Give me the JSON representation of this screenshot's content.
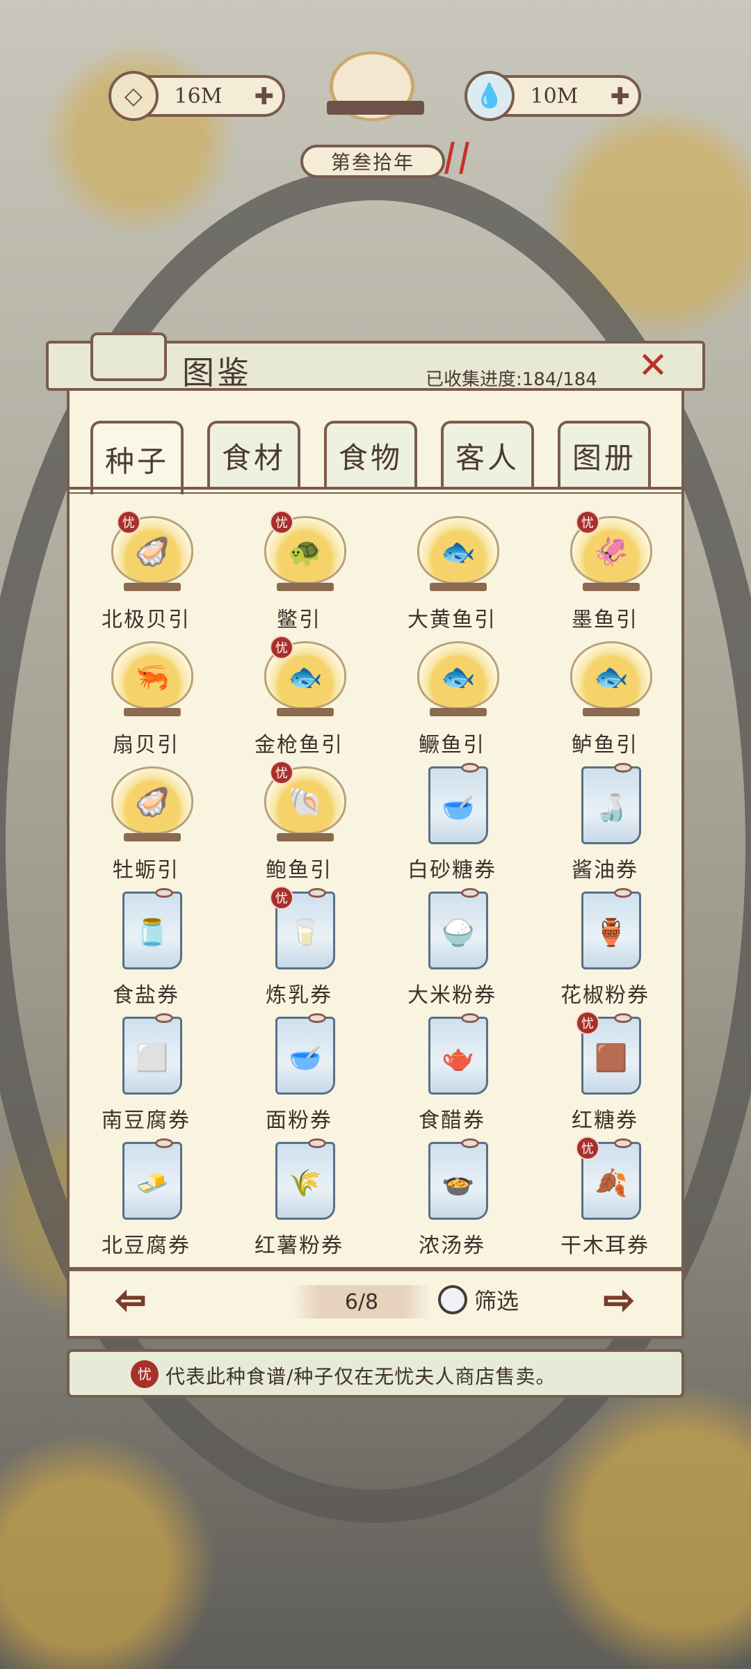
{
  "header": {
    "currency_left": {
      "value": "16M",
      "icon": "coin-icon"
    },
    "currency_right": {
      "value": "10M",
      "icon": "water-drop-icon"
    },
    "year_label": "第叁拾年"
  },
  "panel": {
    "title": "图鉴",
    "progress_label": "已收集进度:",
    "progress_value": "184/184",
    "close_icon": "close-icon"
  },
  "tabs": [
    {
      "label": "种子",
      "active": true
    },
    {
      "label": "食材",
      "active": false
    },
    {
      "label": "食物",
      "active": false
    },
    {
      "label": "客人",
      "active": false
    },
    {
      "label": "图册",
      "active": false
    }
  ],
  "items": [
    {
      "name": "北极贝引",
      "glyph": "🦪",
      "type": "bowl",
      "badge": true
    },
    {
      "name": "鳖引",
      "glyph": "🐢",
      "type": "bowl",
      "badge": true
    },
    {
      "name": "大黄鱼引",
      "glyph": "🐟",
      "type": "bowl",
      "badge": false
    },
    {
      "name": "墨鱼引",
      "glyph": "🦑",
      "type": "bowl",
      "badge": true
    },
    {
      "name": "扇贝引",
      "glyph": "🦐",
      "type": "bowl",
      "badge": false
    },
    {
      "name": "金枪鱼引",
      "glyph": "🐟",
      "type": "bowl",
      "badge": true
    },
    {
      "name": "鳜鱼引",
      "glyph": "🐟",
      "type": "bowl",
      "badge": false
    },
    {
      "name": "鲈鱼引",
      "glyph": "🐟",
      "type": "bowl",
      "badge": false
    },
    {
      "name": "牡蛎引",
      "glyph": "🦪",
      "type": "bowl",
      "badge": false
    },
    {
      "name": "鲍鱼引",
      "glyph": "🐚",
      "type": "bowl",
      "badge": true
    },
    {
      "name": "白砂糖券",
      "glyph": "🥣",
      "type": "coupon",
      "badge": false
    },
    {
      "name": "酱油券",
      "glyph": "🍶",
      "type": "coupon",
      "badge": false
    },
    {
      "name": "食盐券",
      "glyph": "🫙",
      "type": "coupon",
      "badge": false
    },
    {
      "name": "炼乳券",
      "glyph": "🥛",
      "type": "coupon",
      "badge": true
    },
    {
      "name": "大米粉券",
      "glyph": "🍚",
      "type": "coupon",
      "badge": false
    },
    {
      "name": "花椒粉券",
      "glyph": "🏺",
      "type": "coupon",
      "badge": false
    },
    {
      "name": "南豆腐券",
      "glyph": "⬜",
      "type": "coupon",
      "badge": false
    },
    {
      "name": "面粉券",
      "glyph": "🥣",
      "type": "coupon",
      "badge": false
    },
    {
      "name": "食醋券",
      "glyph": "🫖",
      "type": "coupon",
      "badge": false
    },
    {
      "name": "红糖券",
      "glyph": "🟫",
      "type": "coupon",
      "badge": true
    },
    {
      "name": "北豆腐券",
      "glyph": "🧈",
      "type": "coupon",
      "badge": false
    },
    {
      "name": "红薯粉券",
      "glyph": "🌾",
      "type": "coupon",
      "badge": false
    },
    {
      "name": "浓汤券",
      "glyph": "🍲",
      "type": "coupon",
      "badge": false
    },
    {
      "name": "干木耳券",
      "glyph": "🍂",
      "type": "coupon",
      "badge": true
    }
  ],
  "badge_char": "忧",
  "pagination": {
    "page": "6/8",
    "filter_label": "筛选",
    "prev_icon": "arrow-left-icon",
    "next_icon": "arrow-right-icon"
  },
  "footer": {
    "note": "代表此种食谱/种子仅在无忧夫人商店售卖。"
  }
}
